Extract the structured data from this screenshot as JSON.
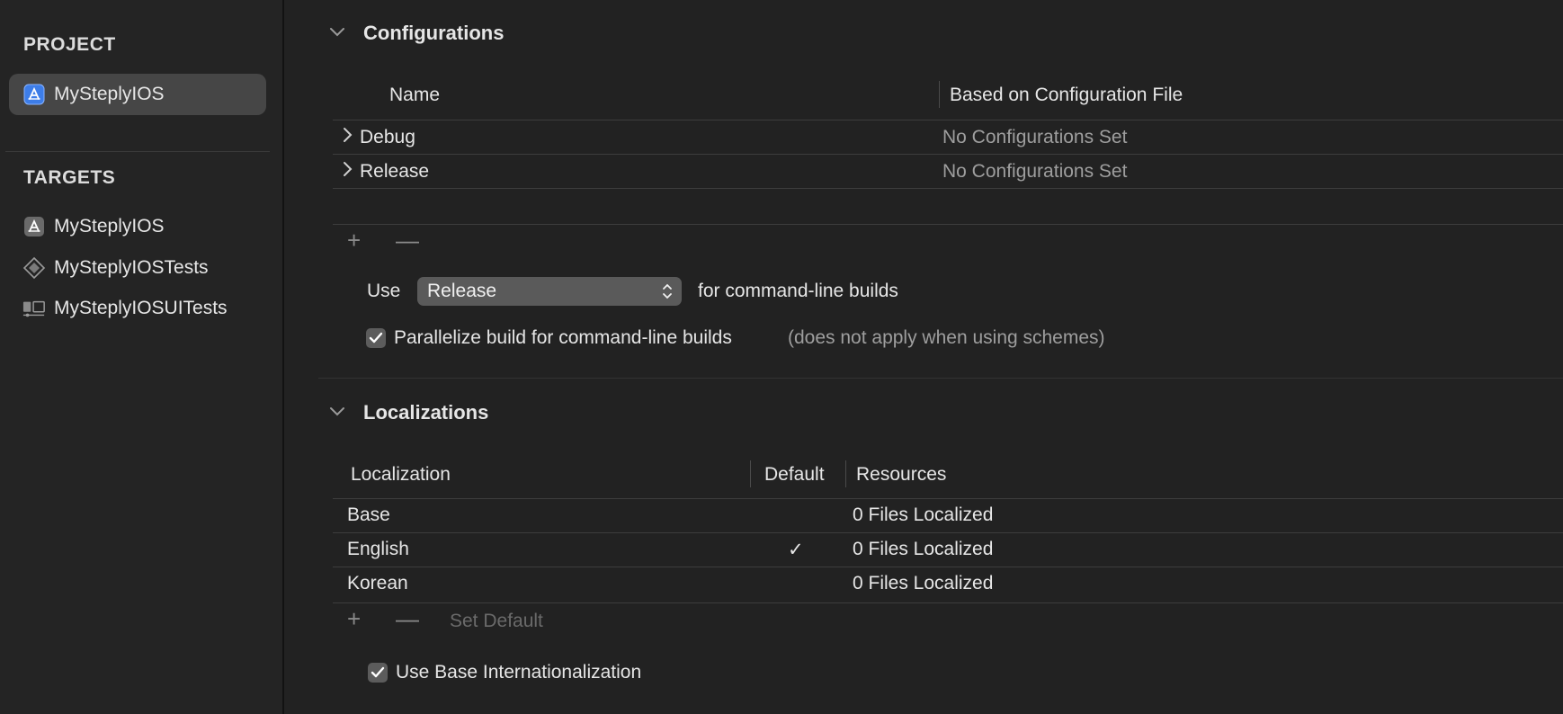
{
  "sidebar": {
    "project_heading": "PROJECT",
    "project_item": {
      "label": "MySteplyIOS",
      "icon": "app-project-icon"
    },
    "targets_heading": "TARGETS",
    "targets": [
      {
        "label": "MySteplyIOS",
        "icon": "app-target-icon"
      },
      {
        "label": "MySteplyIOSTests",
        "icon": "unit-test-icon"
      },
      {
        "label": "MySteplyIOSUITests",
        "icon": "ui-test-icon"
      }
    ]
  },
  "configurations": {
    "title": "Configurations",
    "columns": {
      "name": "Name",
      "based_on": "Based on Configuration File"
    },
    "rows": [
      {
        "name": "Debug",
        "based_on": "No Configurations Set"
      },
      {
        "name": "Release",
        "based_on": "No Configurations Set"
      }
    ],
    "add_button": "+",
    "remove_button": "—",
    "use_label": "Use",
    "use_value": "Release",
    "use_suffix": "for command-line builds",
    "parallelize_label": "Parallelize build for command-line builds",
    "parallelize_note": "(does not apply when using schemes)",
    "parallelize_checked": true
  },
  "localizations": {
    "title": "Localizations",
    "columns": {
      "localization": "Localization",
      "default": "Default",
      "resources": "Resources"
    },
    "rows": [
      {
        "localization": "Base",
        "default": "",
        "resources": "0 Files Localized"
      },
      {
        "localization": "English",
        "default": "✓",
        "resources": "0 Files Localized"
      },
      {
        "localization": "Korean",
        "default": "",
        "resources": "0 Files Localized"
      }
    ],
    "add_button": "+",
    "remove_button": "—",
    "set_default_button": "Set Default",
    "base_intl_label": "Use Base Internationalization",
    "base_intl_checked": true
  },
  "colors": {
    "background": "#222222",
    "sidebar_selected": "#464646",
    "accent_icon": "#4a8cf5"
  }
}
